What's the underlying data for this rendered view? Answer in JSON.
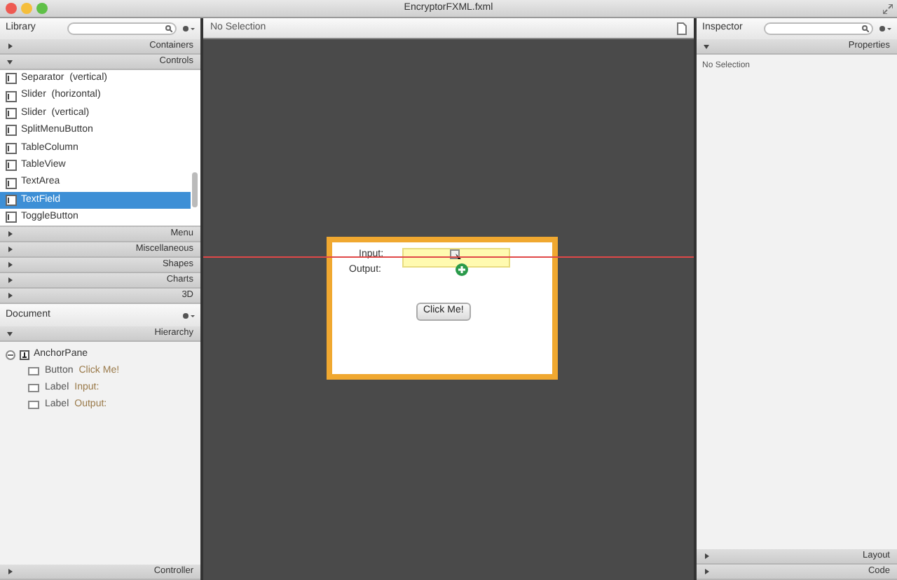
{
  "window": {
    "title": "EncryptorFXML.fxml"
  },
  "library": {
    "title": "Library",
    "sections_top": [
      {
        "label": "Containers",
        "expanded": false
      },
      {
        "label": "Controls",
        "expanded": true
      }
    ],
    "items": [
      {
        "label": "Separator  (vertical)",
        "selected": false
      },
      {
        "label": "Slider  (horizontal)",
        "selected": false
      },
      {
        "label": "Slider  (vertical)",
        "selected": false
      },
      {
        "label": "SplitMenuButton",
        "selected": false
      },
      {
        "label": "TableColumn",
        "selected": false
      },
      {
        "label": "TableView",
        "selected": false
      },
      {
        "label": "TextArea",
        "selected": false
      },
      {
        "label": "TextField",
        "selected": true
      },
      {
        "label": "ToggleButton",
        "selected": false
      }
    ],
    "sections_bottom": [
      {
        "label": "Menu",
        "expanded": false
      },
      {
        "label": "Miscellaneous",
        "expanded": false
      },
      {
        "label": "Shapes",
        "expanded": false
      },
      {
        "label": "Charts",
        "expanded": false
      },
      {
        "label": "3D",
        "expanded": false
      }
    ]
  },
  "document": {
    "title": "Document",
    "section": {
      "label": "Hierarchy",
      "expanded": true
    },
    "tree": [
      {
        "type": "AnchorPane",
        "expanded": true,
        "children": [
          {
            "type": "Button",
            "text": "Click Me!"
          },
          {
            "type": "Label",
            "text": "Input:"
          },
          {
            "type": "Label",
            "text": "Output:"
          }
        ]
      }
    ],
    "footer": {
      "label": "Controller",
      "expanded": false
    }
  },
  "canvas": {
    "status": "No Selection",
    "form": {
      "input_label": "Input:",
      "output_label": "Output:",
      "button": "Click Me!"
    }
  },
  "inspector": {
    "title": "Inspector",
    "section": {
      "label": "Properties",
      "expanded": true
    },
    "message": "No Selection",
    "sections_bottom": [
      {
        "label": "Layout",
        "expanded": false
      },
      {
        "label": "Code",
        "expanded": false
      }
    ]
  }
}
